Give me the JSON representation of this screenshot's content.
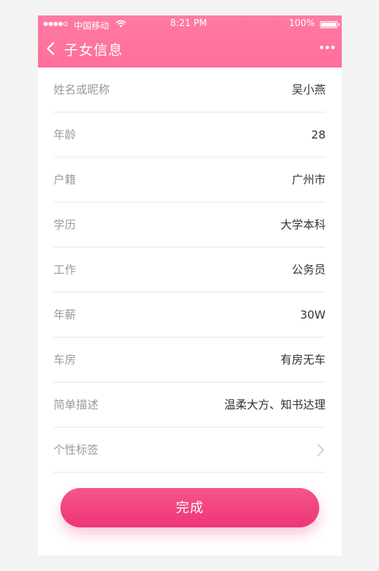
{
  "status_bar": {
    "carrier": "中国移动",
    "time": "8:21 PM",
    "battery": "100%",
    "signal_icon": "signal-dots-icon",
    "wifi_icon": "wifi-icon",
    "battery_icon": "battery-icon"
  },
  "header": {
    "title": "子女信息",
    "back_icon": "chevron-left-icon",
    "more_icon": "more-dots-icon",
    "color": "#ff73a0"
  },
  "fields": [
    {
      "label": "姓名或昵称",
      "value": "吴小燕"
    },
    {
      "label": "年龄",
      "value": "28"
    },
    {
      "label": "户籍",
      "value": "广州市"
    },
    {
      "label": "学历",
      "value": "大学本科"
    },
    {
      "label": "工作",
      "value": "公务员"
    },
    {
      "label": "年薪",
      "value": "30W"
    },
    {
      "label": "车房",
      "value": "有房无车"
    },
    {
      "label": "简单描述",
      "value": "温柔大方、知书达理"
    },
    {
      "label": "个性标签",
      "value": ""
    }
  ],
  "actions": {
    "done_label": "完成",
    "done_color": "#f0407e"
  }
}
